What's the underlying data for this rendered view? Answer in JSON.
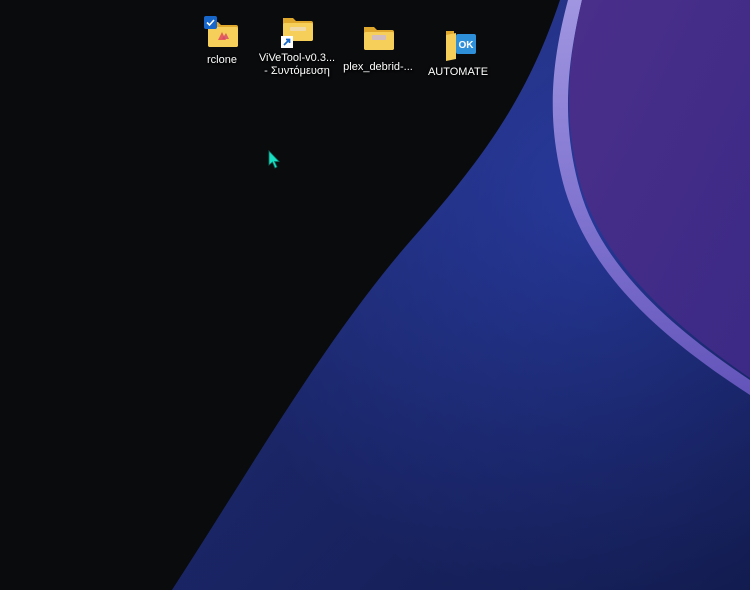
{
  "desktop": {
    "icons": [
      {
        "label": "rclone",
        "icon": "folder-icon",
        "overlay": "sync-check-icon"
      },
      {
        "label_line1": "ViVeTool-v0.3...",
        "label_line2": "- Συντόμευση",
        "icon": "folder-icon",
        "overlay": "shortcut-arrow-icon"
      },
      {
        "label": "plex_debrid-...",
        "icon": "folder-icon"
      },
      {
        "label": "AUTOMATE",
        "icon": "folder-icon",
        "overlay": "ok-badge-icon"
      }
    ]
  },
  "colors": {
    "background": "#0a0b0d",
    "wallpaper_blue": "#26368f",
    "wallpaper_purple": "#4b2f8f",
    "folder_yellow": "#f3c74f",
    "cursor": "#19e0c3"
  }
}
